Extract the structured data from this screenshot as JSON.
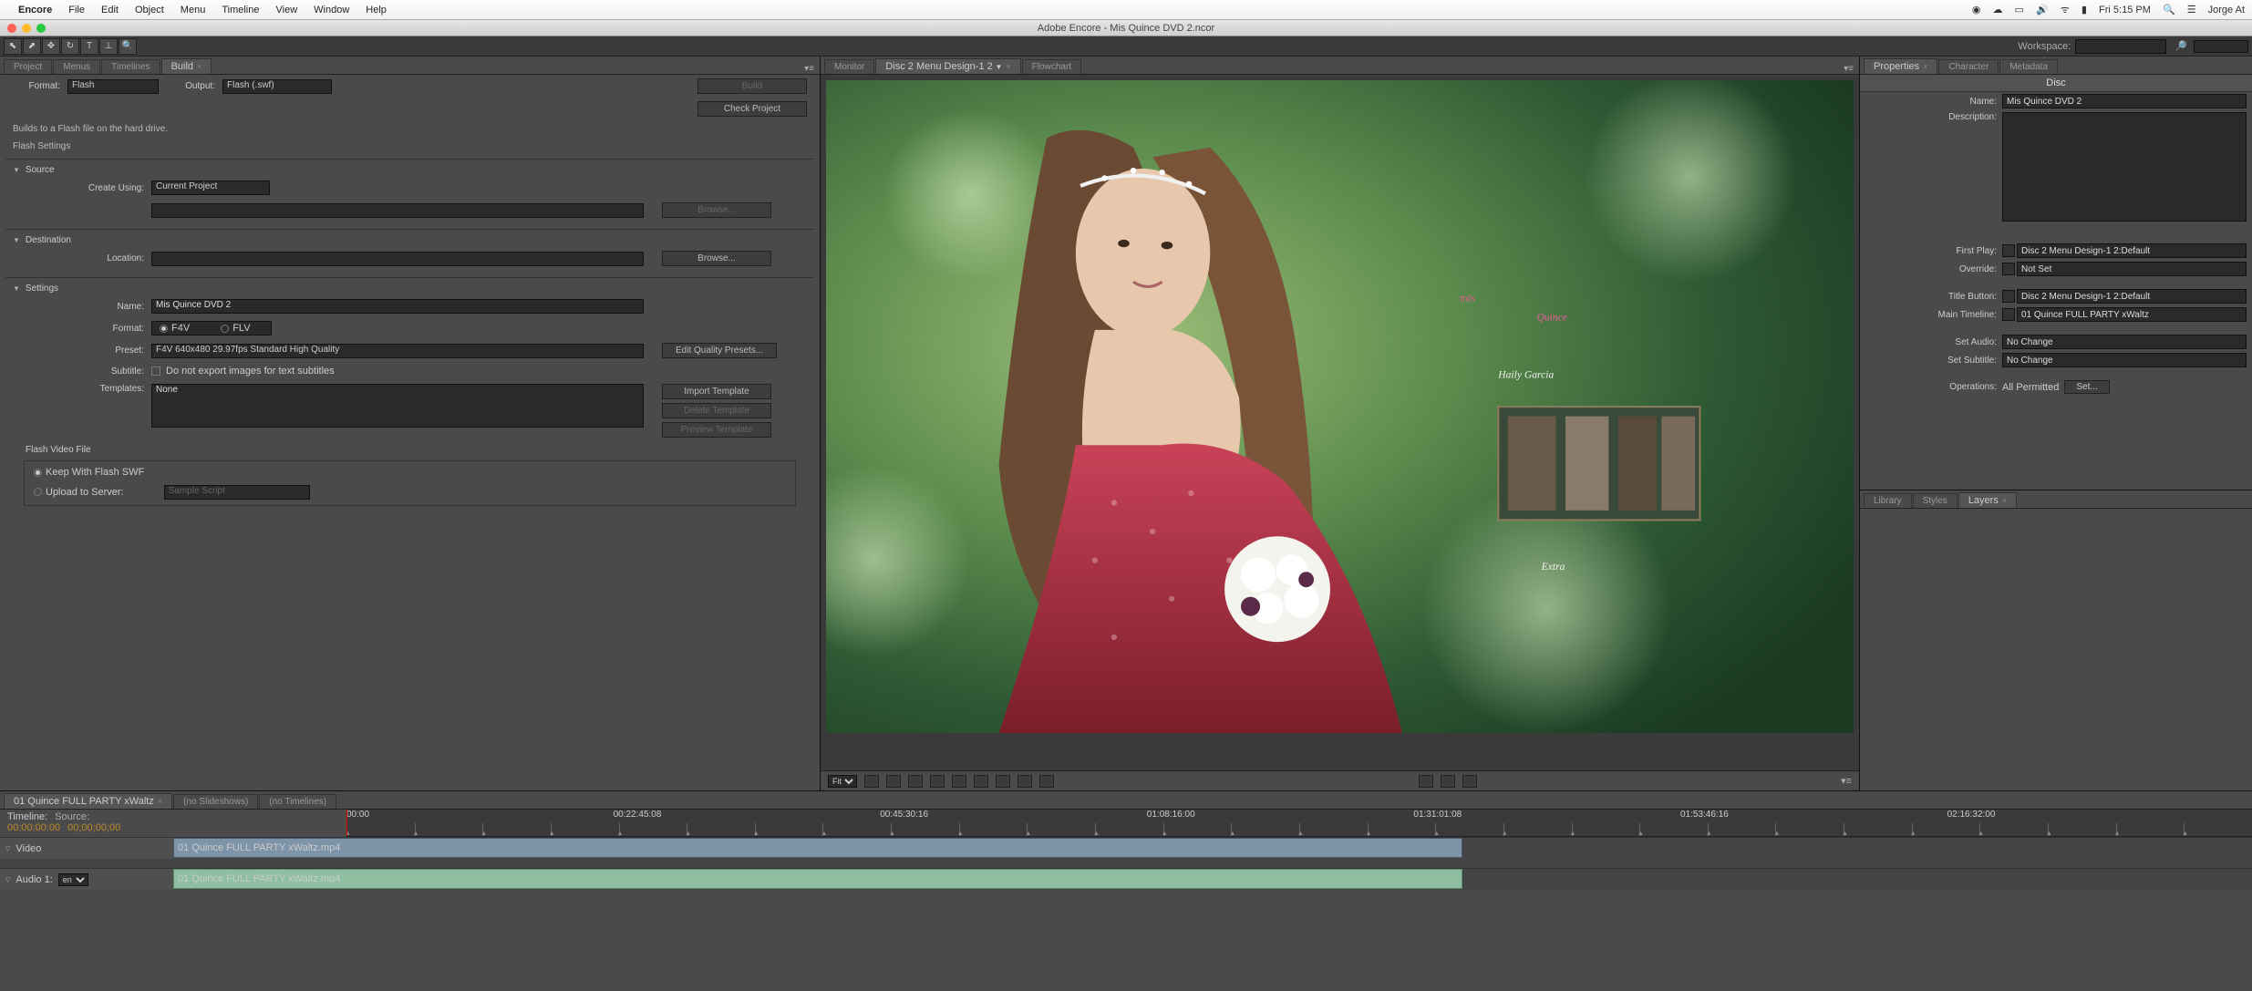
{
  "menubar": {
    "app": "Encore",
    "items": [
      "File",
      "Edit",
      "Object",
      "Menu",
      "Timeline",
      "View",
      "Window",
      "Help"
    ],
    "right": {
      "time": "Fri 5:15 PM",
      "user": "Jorge At"
    }
  },
  "window": {
    "title": "Adobe Encore - Mis Quince DVD 2.ncor"
  },
  "toolbar": {
    "workspace_label": "Workspace:"
  },
  "left_tabs": {
    "items": [
      "Project",
      "Menus",
      "Timelines",
      "Build"
    ],
    "active": 3
  },
  "build": {
    "format_label": "Format:",
    "format_value": "Flash",
    "output_label": "Output:",
    "output_value": "Flash (.swf)",
    "build_btn": "Build",
    "check_btn": "Check Project",
    "note": "Builds to a Flash file on the hard drive.",
    "flash_settings": "Flash Settings",
    "source": "Source",
    "create_using_label": "Create Using:",
    "create_using_value": "Current Project",
    "browse": "Browse...",
    "destination": "Destination",
    "location_label": "Location:",
    "settings": "Settings",
    "name_label": "Name:",
    "name_value": "Mis Quince DVD 2",
    "format2_label": "Format:",
    "f4v": "F4V",
    "flv": "FLV",
    "preset_label": "Preset:",
    "preset_value": "F4V 640x480 29.97fps Standard High Quality",
    "edit_presets": "Edit Quality Presets...",
    "subtitle_label": "Subtitle:",
    "subtitle_chk": "Do not export images for text subtitles",
    "templates_label": "Templates:",
    "templates_value": "None",
    "import_tpl": "Import Template",
    "delete_tpl": "Delete Template",
    "preview_tpl": "Preview Template",
    "flash_video_file": "Flash Video File",
    "keep_swf": "Keep With Flash SWF",
    "upload": "Upload to Server:",
    "sample_script": "Sample Script"
  },
  "monitor_tabs": {
    "items": [
      "Monitor",
      "Disc 2 Menu Design-1 2",
      "Flowchart"
    ],
    "active": 1
  },
  "monitor": {
    "fit": "Fit",
    "menu_text": {
      "mis": "mis",
      "quince": "Quince",
      "name": "Haily Garcia",
      "extra": "Extra"
    }
  },
  "props_tabs": {
    "items": [
      "Properties",
      "Character",
      "Metadata"
    ],
    "active": 0
  },
  "props": {
    "disc": "Disc",
    "name_label": "Name:",
    "name_value": "Mis Quince DVD 2",
    "desc_label": "Description:",
    "first_play_label": "First Play:",
    "first_play_value": "Disc 2 Menu Design-1 2:Default",
    "override_label": "Override:",
    "override_value": "Not Set",
    "title_button_label": "Title Button:",
    "title_button_value": "Disc 2 Menu Design-1 2:Default",
    "main_timeline_label": "Main Timeline:",
    "main_timeline_value": "01 Quince FULL PARTY xWaltz",
    "set_audio_label": "Set Audio:",
    "set_audio_value": "No Change",
    "set_subtitle_label": "Set Subtitle:",
    "set_subtitle_value": "No Change",
    "operations_label": "Operations:",
    "operations_value": "All Permitted",
    "set_btn": "Set..."
  },
  "lower_tabs": {
    "items": [
      "Library",
      "Styles",
      "Layers"
    ],
    "active": 2
  },
  "timeline_tabs": {
    "items": [
      "01 Quince FULL PARTY xWaltz",
      "(no Slideshows)",
      "(no Timelines)"
    ],
    "active": 0
  },
  "timeline": {
    "tl_label": "Timeline:",
    "src_label": "Source:",
    "tl_tc": "00:00:00:00",
    "src_tc": "00;00;00;00",
    "ruler": [
      "00:00",
      "00:22:45:08",
      "00:45:30:16",
      "01:08:16:00",
      "01:31:01:08",
      "01:53:46:16",
      "02:16:32:00"
    ],
    "video_label": "Video",
    "audio_label": "Audio 1:",
    "audio_lang": "en",
    "video_clip": "01 Quince FULL PARTY xWaltz.mp4",
    "audio_clip": "01 Quince FULL PARTY xWaltz.mp4"
  }
}
